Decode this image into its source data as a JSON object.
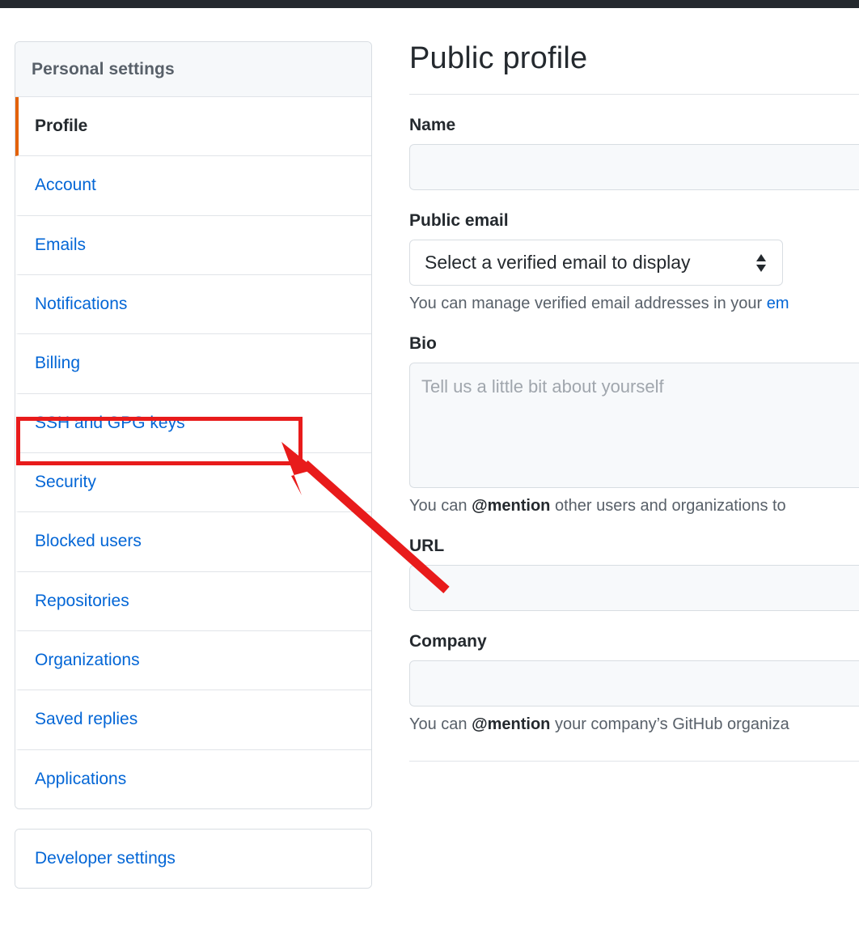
{
  "topbar": {
    "color": "#24292e"
  },
  "sidebar": {
    "header": "Personal settings",
    "items": [
      {
        "label": "Profile",
        "selected": true
      },
      {
        "label": "Account",
        "selected": false
      },
      {
        "label": "Emails",
        "selected": false
      },
      {
        "label": "Notifications",
        "selected": false
      },
      {
        "label": "Billing",
        "selected": false
      },
      {
        "label": "SSH and GPG keys",
        "selected": false
      },
      {
        "label": "Security",
        "selected": false
      },
      {
        "label": "Blocked users",
        "selected": false
      },
      {
        "label": "Repositories",
        "selected": false
      },
      {
        "label": "Organizations",
        "selected": false
      },
      {
        "label": "Saved replies",
        "selected": false
      },
      {
        "label": "Applications",
        "selected": false
      }
    ],
    "developer": {
      "label": "Developer settings"
    },
    "accent_color": "#e36209",
    "link_color": "#0366d6"
  },
  "main": {
    "title": "Public profile",
    "name": {
      "label": "Name",
      "value": ""
    },
    "public_email": {
      "label": "Public email",
      "selected_option": "Select a verified email to display",
      "options": [
        "Select a verified email to display"
      ],
      "help_prefix": "You can manage verified email addresses in your ",
      "help_link": "em"
    },
    "bio": {
      "label": "Bio",
      "value": "",
      "placeholder": "Tell us a little bit about yourself",
      "help_pre": "You can ",
      "help_mention": "@mention",
      "help_post": " other users and organizations to"
    },
    "url": {
      "label": "URL",
      "value": ""
    },
    "company": {
      "label": "Company",
      "value": "",
      "help_pre": "You can ",
      "help_mention": "@mention",
      "help_post": " your company’s GitHub organiza"
    }
  },
  "annotation": {
    "box_color": "#e81b1b",
    "arrow_color": "#e81b1b",
    "target": "SSH and GPG keys"
  }
}
